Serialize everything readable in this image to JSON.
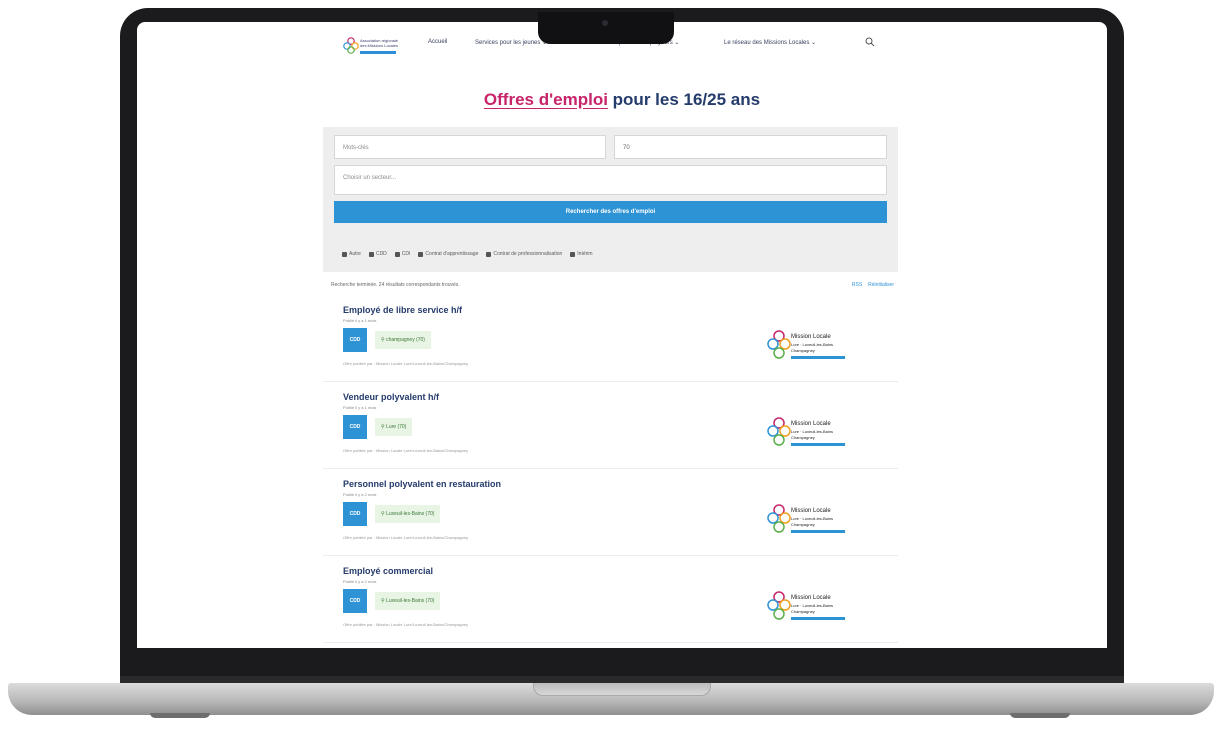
{
  "nav": {
    "logo_lines": [
      "Association régionale",
      "des Missions Locales"
    ],
    "items": [
      {
        "label": "Accueil",
        "has_dropdown": false
      },
      {
        "label": "Services pour les jeunes",
        "has_dropdown": true
      },
      {
        "label": "Services pour les employeurs",
        "has_dropdown": true
      },
      {
        "label": "Le réseau des Missions Locales",
        "has_dropdown": true
      }
    ],
    "search_icon": "search-icon"
  },
  "page": {
    "title_accent": "Offres d'emploi",
    "title_rest": " pour les 16/25 ans"
  },
  "search": {
    "keywords_placeholder": "Mots-clés",
    "location_value": "70",
    "sector_placeholder": "Choisir un secteur...",
    "submit_label": "Rechercher des offres d'emploi",
    "filters": [
      "Autre",
      "CDD",
      "CDI",
      "Contrat d'apprentissage",
      "Contrat de professionnalisation",
      "Intérim"
    ]
  },
  "results": {
    "summary": "Recherche terminée. 24 résultats correspondants trouvés.",
    "rss_label": "RSS",
    "reset_label": "Réinitialiser"
  },
  "jobs": [
    {
      "title": "Employé de libre service h/f",
      "posted": "Publié il y a 1 mois",
      "type": "CDD",
      "location": "champagney (70)",
      "published_by": "Offre publiée par : Mission Locale Lure/Luxeuil-les-Bains/Champagney"
    },
    {
      "title": "Vendeur polyvalent h/f",
      "posted": "Publié il y a 1 mois",
      "type": "CDD",
      "location": "Lure (70)",
      "published_by": "Offre publiée par : Mission Locale Lure/Luxeuil-les-Bains/Champagney"
    },
    {
      "title": "Personnel polyvalent en restauration",
      "posted": "Publié il y a 2 mois",
      "type": "CDD",
      "location": "Luxeuil-les-Bains (70)",
      "published_by": "Offre publiée par : Mission Locale Lure/Luxeuil-les-Bains/Champagney"
    },
    {
      "title": "Employé commercial",
      "posted": "Publié il y a 2 mois",
      "type": "CDD",
      "location": "Luxeuil-les-Bains (70)",
      "published_by": "Offre publiée par : Mission Locale Lure/Luxeuil-les-Bains/Champagney"
    }
  ],
  "org_logo_lines": [
    "Mission Locale",
    "Lure · Luxeuil-les-Bains",
    "Champagney"
  ],
  "colors": {
    "accent": "#c7246a",
    "primary": "#2e93d5",
    "heading": "#243b6b"
  }
}
